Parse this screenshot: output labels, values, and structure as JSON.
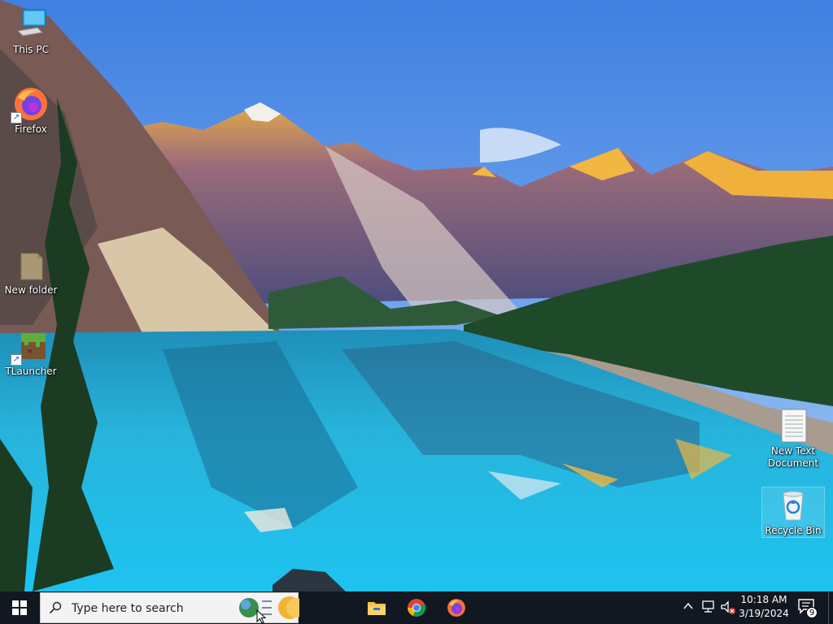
{
  "desktop": {
    "icons": [
      {
        "label": "This PC",
        "icon": "computer-icon"
      },
      {
        "label": "Firefox",
        "icon": "firefox-icon"
      },
      {
        "label": "New folder",
        "icon": "folder-icon"
      },
      {
        "label": "TLauncher",
        "icon": "grass-block-icon"
      },
      {
        "label": "New Text Document",
        "icon": "text-document-icon"
      },
      {
        "label": "Recycle Bin",
        "icon": "recycle-bin-icon"
      }
    ]
  },
  "taskbar": {
    "search_placeholder": "Type here to search",
    "pinned_apps": [
      {
        "icon": "file-explorer-icon"
      },
      {
        "icon": "chrome-icon"
      },
      {
        "icon": "firefox-icon"
      }
    ],
    "clock": {
      "time": "10:18 AM",
      "date": "3/19/2024"
    },
    "notification_count": "9"
  },
  "colors": {
    "taskbar_bg": "#121821",
    "accent": "#0078d4"
  }
}
